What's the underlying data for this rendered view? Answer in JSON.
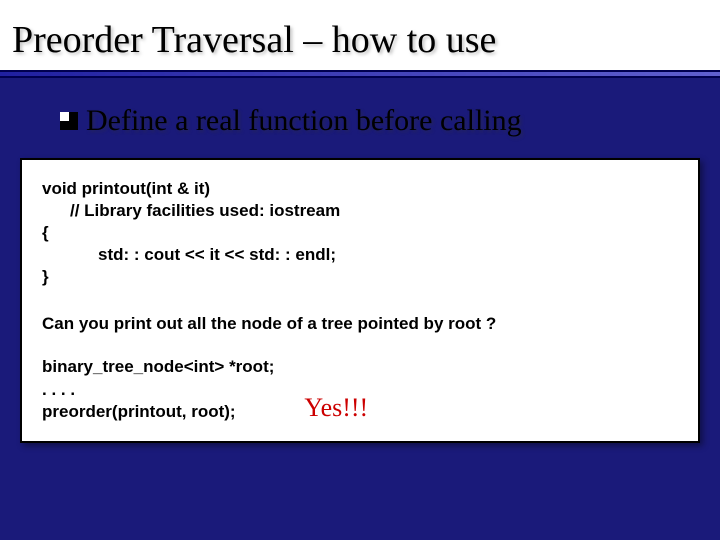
{
  "title": "Preorder Traversal – how to use",
  "bullet": "Define a real function before calling",
  "code": {
    "l1": "void printout(int & it)",
    "l2": "// Library facilities used: iostream",
    "l3": "{",
    "l4": "std: : cout <<  it << std: : endl;",
    "l5": "}"
  },
  "question": "Can you print out all the node of a tree pointed by root ?",
  "bottom": {
    "l1": "binary_tree_node<int> *root;",
    "l2": ". . . .",
    "l3": "preorder(printout, root);"
  },
  "answer": "Yes!!!"
}
